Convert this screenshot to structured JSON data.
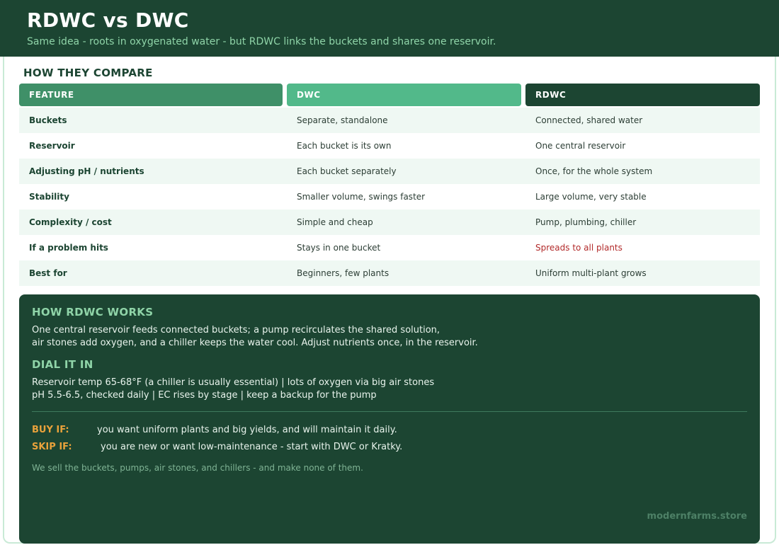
{
  "header": {
    "title": "RDWC vs DWC",
    "subtitle": "Same idea - roots in oxygenated water - but RDWC links the buckets and shares one reservoir."
  },
  "compare": {
    "section_title": "HOW THEY COMPARE",
    "columns": [
      "FEATURE",
      "DWC",
      "RDWC"
    ],
    "rows": [
      {
        "feature": "Buckets",
        "dwc": "Separate, standalone",
        "rdwc": "Connected, shared water"
      },
      {
        "feature": "Reservoir",
        "dwc": "Each bucket is its own",
        "rdwc": "One central reservoir"
      },
      {
        "feature": "Adjusting pH / nutrients",
        "dwc": "Each bucket separately",
        "rdwc": "Once, for the whole system"
      },
      {
        "feature": "Stability",
        "dwc": "Smaller volume, swings faster",
        "rdwc": "Large volume, very stable"
      },
      {
        "feature": "Complexity / cost",
        "dwc": "Simple and cheap",
        "rdwc": "Pump, plumbing, chiller"
      },
      {
        "feature": "If a problem hits",
        "dwc": "Stays in one bucket",
        "rdwc": "Spreads to all plants"
      },
      {
        "feature": "Best for",
        "dwc": "Beginners, few plants",
        "rdwc": "Uniform multi-plant grows"
      }
    ]
  },
  "how": {
    "title": "HOW RDWC WORKS",
    "line1": "One central reservoir feeds connected buckets; a pump recirculates the shared solution,",
    "line2": "air stones add oxygen, and a chiller keeps the water cool. Adjust nutrients once, in the reservoir."
  },
  "dial": {
    "title": "DIAL IT IN",
    "line1": "Reservoir temp 65-68°F (a chiller is usually essential) | lots of oxygen via big air stones",
    "line2": "pH 5.5-6.5, checked daily | EC rises by stage | keep a backup for the pump"
  },
  "verdict": {
    "buy_label": "BUY IF:",
    "buy_text": "you want uniform plants and big yields, and will maintain it daily.",
    "skip_label": "SKIP IF:",
    "skip_text": "you are new or want low-maintenance - start with DWC or Kratky."
  },
  "note": "We sell the buckets, pumps, air stones, and chillers - and make none of them.",
  "brand": "modernfarms.store",
  "colors": {
    "dark_green": "#1c4532",
    "mid_green": "#3f9068",
    "light_green": "#52b98a",
    "accent_text": "#8fd4a8",
    "warning_red": "#b22a2a",
    "verdict_orange": "#e9a23b"
  }
}
